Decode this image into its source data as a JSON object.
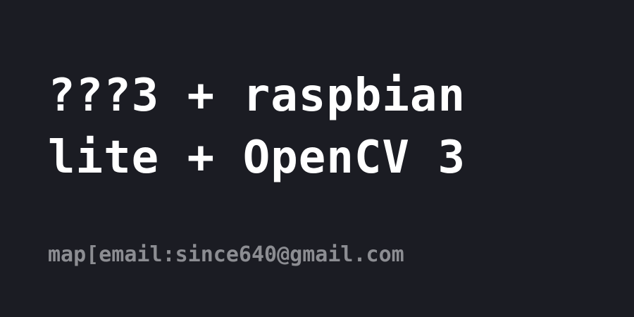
{
  "post": {
    "title_lines": [
      "???3 + raspbian",
      "lite + OpenCV 3"
    ],
    "author_line": "map[email:since640@gmail.com"
  },
  "colors": {
    "background": "#1b1c23",
    "title": "#ffffff",
    "author": "#8c8d92"
  }
}
